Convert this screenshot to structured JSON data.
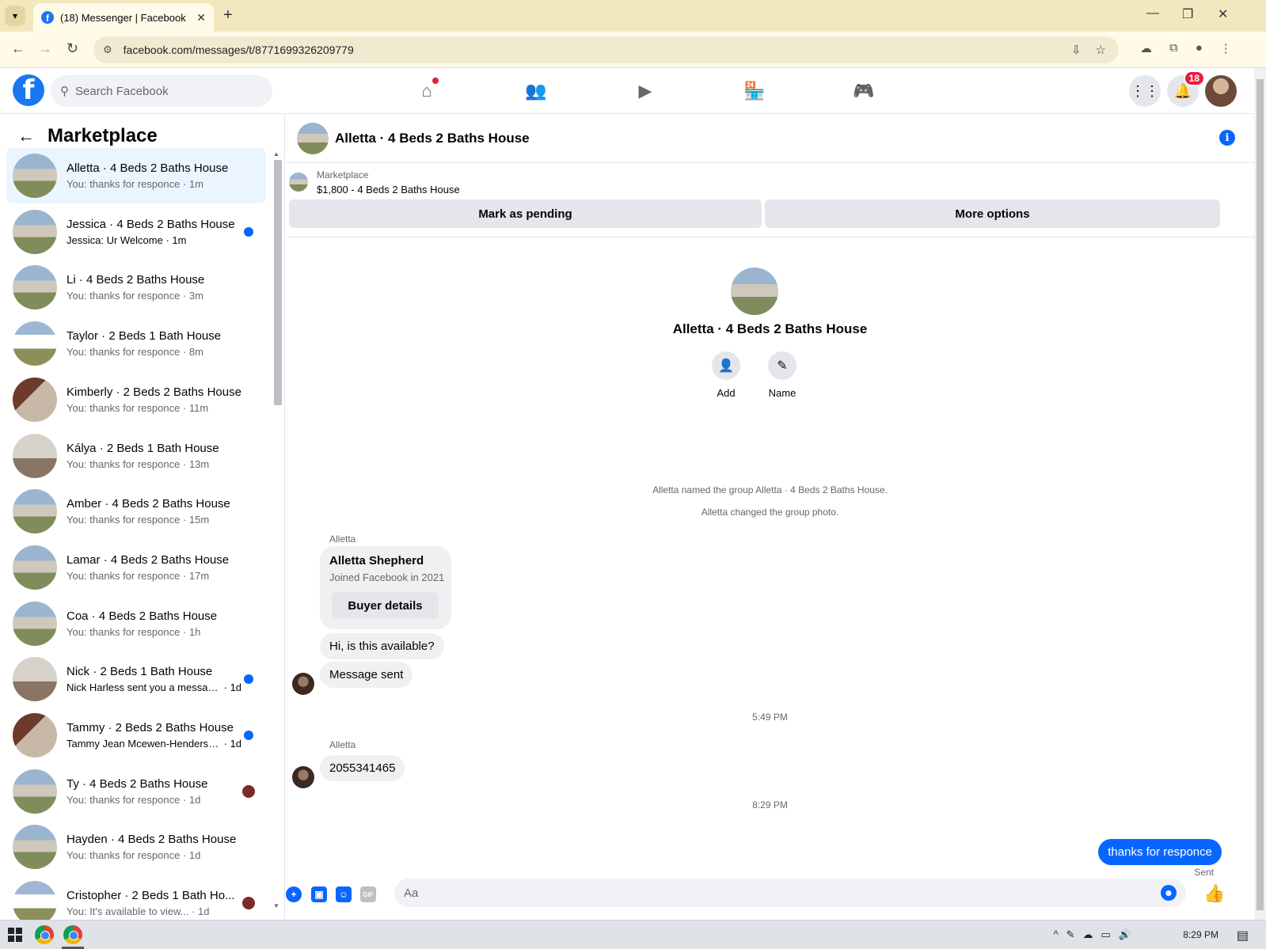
{
  "browser": {
    "tab_title": "(18) Messenger | Facebook",
    "tab_close": "✕",
    "new_tab": "+",
    "url": "facebook.com/messages/t/8771699326209779",
    "win_min": "—",
    "win_max": "❐",
    "win_close": "✕"
  },
  "header": {
    "search_placeholder": "Search Facebook",
    "notifications_count": "18",
    "logo": "f"
  },
  "sidebar": {
    "title": "Marketplace",
    "conversations": [
      {
        "name": "Alletta · 4 Beds 2 Baths House",
        "preview": "You: thanks for responce",
        "time": "1m",
        "active": true
      },
      {
        "name": "Jessica · 4 Beds 2 Baths House",
        "preview": "Jessica: Ur Welcome",
        "time": "1m",
        "unread": true
      },
      {
        "name": "Li · 4 Beds 2 Baths House",
        "preview": "You: thanks for responce",
        "time": "3m"
      },
      {
        "name": "Taylor · 2 Beds 1 Bath House",
        "preview": "You: thanks for responce",
        "time": "8m"
      },
      {
        "name": "Kimberly · 2 Beds 2 Baths House",
        "preview": "You: thanks for responce",
        "time": "11m"
      },
      {
        "name": "Kályа · 2 Beds 1 Bath House",
        "preview": "You: thanks for responce",
        "time": "13m"
      },
      {
        "name": "Amber · 4 Beds 2 Baths House",
        "preview": "You: thanks for responce",
        "time": "15m"
      },
      {
        "name": "Lamar · 4 Beds 2 Baths House",
        "preview": "You: thanks for responce",
        "time": "17m"
      },
      {
        "name": "Coa · 4 Beds 2 Baths House",
        "preview": "You: thanks for responce",
        "time": "1h"
      },
      {
        "name": "Nick · 2 Beds 1 Bath House",
        "preview": "Nick Harless sent you a messag...",
        "time": "1d",
        "unread": true
      },
      {
        "name": "Tammy · 2 Beds 2 Baths House",
        "preview": "Tammy Jean Mcewen-Henderso...",
        "time": "1d",
        "unread": true
      },
      {
        "name": "Ty · 4 Beds 2 Baths House",
        "preview": "You: thanks for responce",
        "time": "1d"
      },
      {
        "name": "Hayden · 4 Beds 2 Baths House",
        "preview": "You: thanks for responce",
        "time": "1d"
      },
      {
        "name": "Cristopher · 2 Beds 1 Bath Ho...",
        "preview": "You: It's available to view...",
        "time": "1d"
      }
    ]
  },
  "chat": {
    "title": "Alletta · 4 Beds 2 Baths House",
    "listing_source": "Marketplace",
    "listing_price": "$1,800 - 4 Beds 2 Baths House",
    "mark_pending": "Mark as pending",
    "more_options": "More options",
    "intro_name": "Alletta · 4 Beds 2 Baths House",
    "add_label": "Add",
    "name_label": "Name",
    "sys1": "Alletta named the group Alletta · 4 Beds 2 Baths House.",
    "sys2": "Alletta changed the group photo.",
    "sender1": "Alletta",
    "card_name": "Alletta Shepherd",
    "card_joined": "Joined Facebook in 2021",
    "buyer_details": "Buyer details",
    "msg1": "Hi, is this available?",
    "msg2": "Message sent",
    "time1": "5:49 PM",
    "sender2": "Alletta",
    "msg3": "2055341465",
    "time2": "8:29 PM",
    "mine": "thanks for responce",
    "sent": "Sent",
    "composer_placeholder": "Aa"
  },
  "taskbar": {
    "clock": "8:29 PM"
  },
  "colors": {
    "accent": "#0866ff",
    "fb_blue": "#1877f2",
    "badge_red": "#e41e3f"
  }
}
